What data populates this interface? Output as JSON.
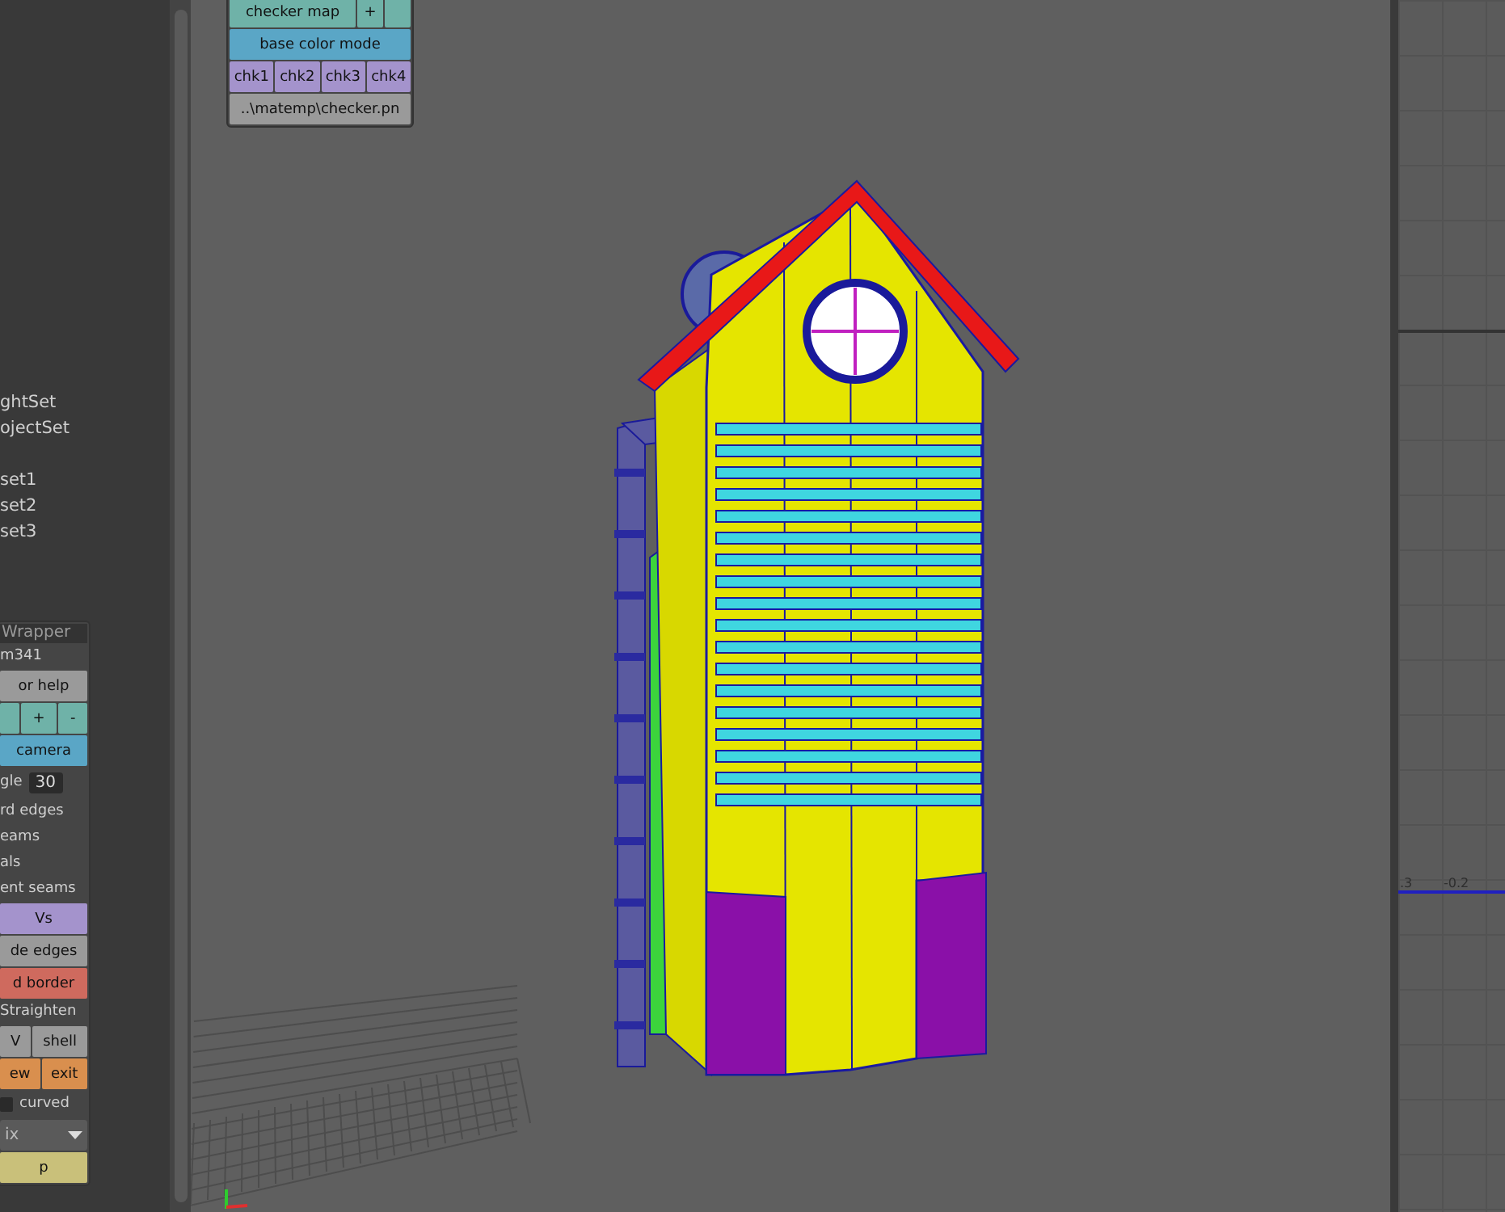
{
  "outliner": {
    "items": [
      "ghtSet",
      "ojectSet",
      "set1",
      "set2",
      "set3"
    ]
  },
  "checker_panel": {
    "map_row": {
      "label": "checker map",
      "button": "+",
      "color": "#6fb2a8"
    },
    "rows": [
      {
        "color": "#5aa6c6",
        "cells": [
          "base color mode"
        ]
      },
      {
        "color": "#a493cc",
        "cells": [
          "chk1",
          "chk2",
          "chk3",
          "chk4"
        ]
      },
      {
        "color": "#9a9a9a",
        "cells": [
          "..\\matemp\\checker.pn"
        ]
      }
    ]
  },
  "tool_panel": {
    "title": "Wrapper",
    "rows": [
      {
        "kind": "label",
        "text": "m341"
      },
      {
        "kind": "buttons",
        "color": "#9a9a9a",
        "cells": [
          "or help"
        ]
      },
      {
        "kind": "buttons",
        "color": "#6fb2a8",
        "cut_button": true,
        "cells": [
          "+",
          "-"
        ]
      },
      {
        "kind": "buttons",
        "color": "#5aa6c6",
        "cells": [
          "camera"
        ]
      },
      {
        "kind": "field",
        "text": "gle",
        "value": "30"
      },
      {
        "kind": "label",
        "text": "rd edges"
      },
      {
        "kind": "label",
        "text": "eams"
      },
      {
        "kind": "label",
        "text": "als"
      },
      {
        "kind": "label",
        "text": "ent seams"
      },
      {
        "kind": "buttons",
        "color": "#a493cc",
        "cells": [
          "Vs"
        ]
      },
      {
        "kind": "buttons",
        "color": "#9a9a9a",
        "cells": [
          "de edges"
        ]
      },
      {
        "kind": "buttons",
        "color": "#cf6a5e",
        "cells": [
          "d border"
        ]
      },
      {
        "kind": "label",
        "text": "Straighten"
      },
      {
        "kind": "buttons",
        "color": "#9a9a9a",
        "cells": [
          "V",
          "shell"
        ]
      },
      {
        "kind": "buttons",
        "color": "#d98f4e",
        "cells": [
          "ew",
          "exit"
        ]
      },
      {
        "kind": "check",
        "text": "curved",
        "checked": false
      },
      {
        "kind": "dropdown",
        "text": "ix"
      },
      {
        "kind": "buttons",
        "color": "#c9c07a",
        "cells": [
          "p"
        ]
      }
    ]
  },
  "uv_editor": {
    "tick_labels": [
      ".3",
      "-0.2"
    ]
  }
}
